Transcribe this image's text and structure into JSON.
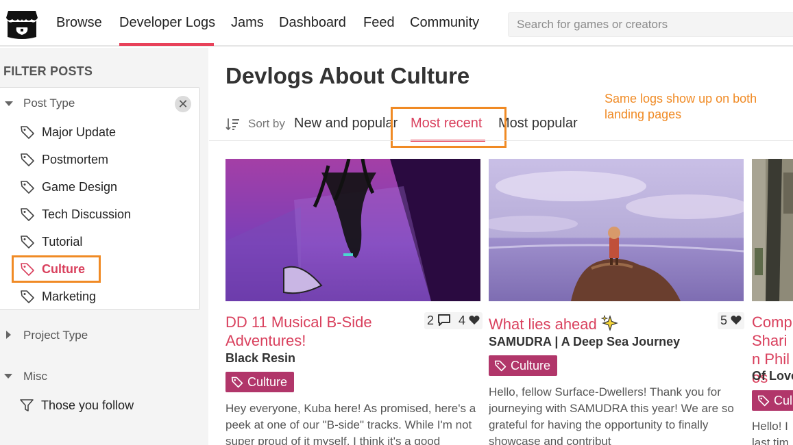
{
  "header": {
    "nav": [
      "Browse",
      "Developer Logs",
      "Jams",
      "Dashboard",
      "Feed",
      "Community"
    ],
    "search_placeholder": "Search for games or creators"
  },
  "sidebar": {
    "title": "FILTER POSTS",
    "post_type_label": "Post Type",
    "post_types": [
      "Major Update",
      "Postmortem",
      "Game Design",
      "Tech Discussion",
      "Tutorial",
      "Culture",
      "Marketing"
    ],
    "selected_post_type": "Culture",
    "project_type_label": "Project Type",
    "misc_label": "Misc",
    "misc_items": [
      "Those you follow"
    ]
  },
  "main": {
    "title": "Devlogs About Culture",
    "annotation": "Same logs show up on both landing pages",
    "sort_label": "Sort by",
    "sort_options": [
      "New and popular",
      "Most recent",
      "Most popular"
    ],
    "active_sort": "Most recent",
    "cards": [
      {
        "title": "DD 11 Musical B-Side Adventures!",
        "game": "Black Resin",
        "comments": "2",
        "likes": "4",
        "tag": "Culture",
        "excerpt": "Hey everyone, Kuba here! As promised, here's a peek at one of our \"B-side\" tracks. While I'm not super proud of it myself, I think it's a good"
      },
      {
        "title": "What lies ahead",
        "game": "SAMUDRA | A Deep Sea Journey",
        "likes": "5",
        "tag": "Culture",
        "excerpt": "Hello, fellow Surface-Dwellers! Thank you for journeying with SAMUDRA this year! We are so grateful for having the opportunity to finally showcase and contribut"
      },
      {
        "title": "Comp Sharin Philos",
        "game": "Of Love",
        "tag": "Cul",
        "excerpt": "Hello! I last tim"
      }
    ]
  },
  "colors": {
    "accent": "#e8425a",
    "tag_bg": "#b1366a",
    "annotation": "#f08a24"
  }
}
